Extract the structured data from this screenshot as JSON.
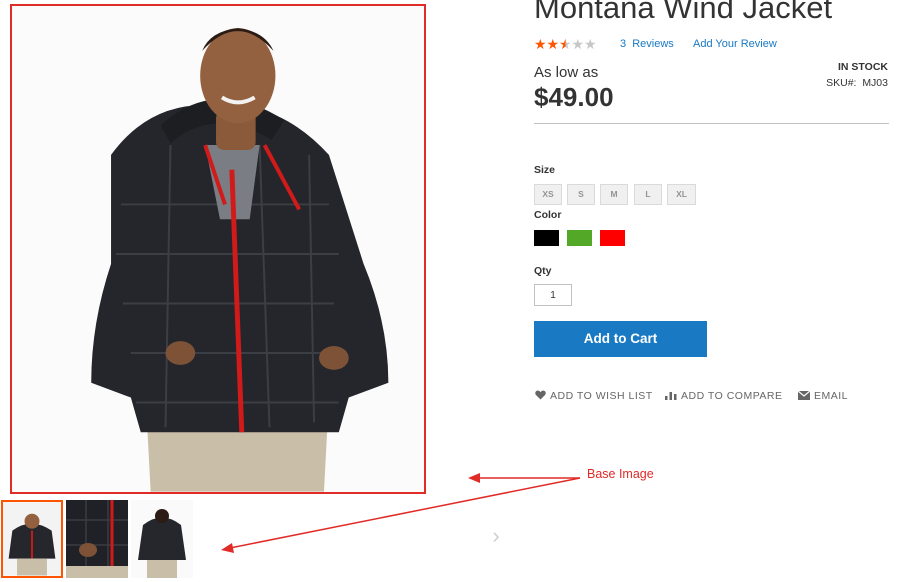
{
  "product": {
    "title": "Montana Wind Jacket",
    "rating": {
      "stars_filled": 2.5,
      "stars_total": 5
    },
    "reviews_link": "3  Reviews",
    "add_review_link": "Add Your Review",
    "price_prefix": "As low as",
    "price": "$49.00",
    "stock": "IN STOCK",
    "sku_label": "SKU#:",
    "sku_value": "MJ03"
  },
  "options": {
    "size_label": "Size",
    "sizes": [
      "XS",
      "S",
      "M",
      "L",
      "XL"
    ],
    "color_label": "Color",
    "colors": [
      {
        "name": "Black",
        "hex": "#000000"
      },
      {
        "name": "Green",
        "hex": "#53a828"
      },
      {
        "name": "Red",
        "hex": "#ff0000"
      }
    ],
    "qty_label": "Qty",
    "qty_value": "1"
  },
  "actions": {
    "add_to_cart": "Add to Cart",
    "wish_list": "ADD TO WISH LIST",
    "compare": "ADD TO COMPARE",
    "email": "EMAIL"
  },
  "gallery": {
    "thumbnail_count": 3,
    "active_index": 0,
    "next_icon": "chevron-right-icon"
  },
  "annotation": {
    "label": "Base Image",
    "color": "#e02b27"
  },
  "theme": {
    "accent": "#1979c3",
    "star": "#ff5501",
    "thumb_active": "#ff5501"
  }
}
